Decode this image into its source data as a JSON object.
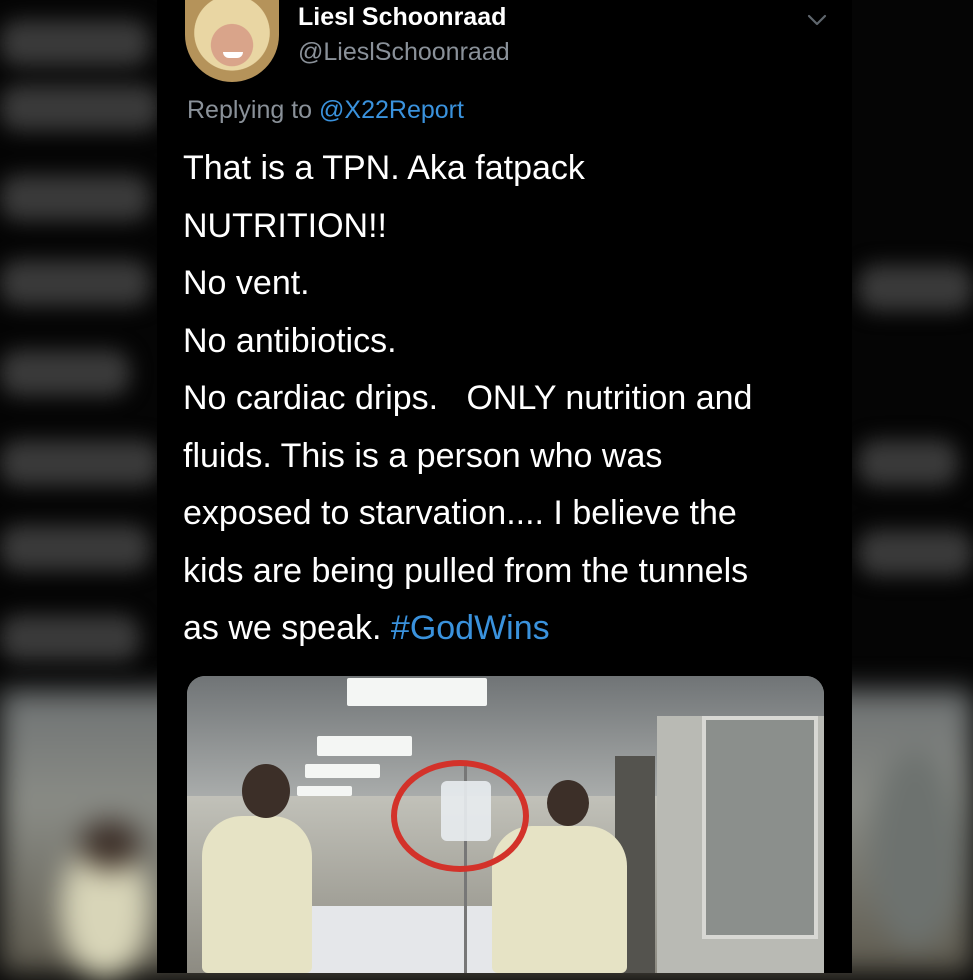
{
  "tweet": {
    "display_name": "Liesl Schoonraad",
    "handle": "@LieslSchoonraad",
    "replying_prefix": "Replying to",
    "replying_to": "@X22Report",
    "lines": [
      "That is a TPN. Aka fatpack",
      "NUTRITION!!",
      "No vent.",
      "No antibiotics.",
      "No cardiac drips.   ONLY nutrition and",
      "fluids. This is a person who was",
      "exposed to starvation.... I believe the",
      "kids are being pulled from the tunnels"
    ],
    "last_line_text": "as we speak.",
    "hashtag": "#GodWins"
  },
  "colors": {
    "background": "#000000",
    "link": "#3a92dd",
    "secondary_text": "#8a9199",
    "highlight_circle": "#d3322a"
  },
  "icons": {
    "menu": "chevron-down-icon"
  }
}
